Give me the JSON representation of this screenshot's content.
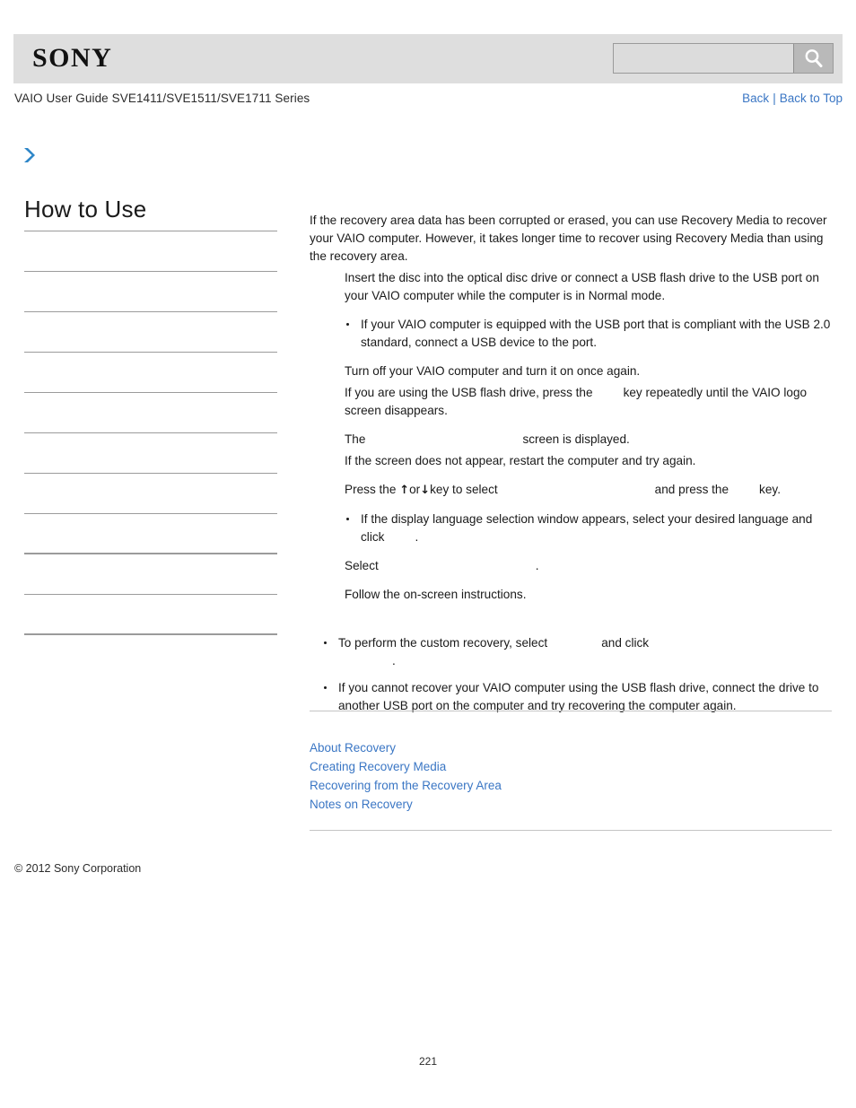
{
  "header": {
    "logo_text": "SONY",
    "search": {
      "value": "",
      "placeholder": "",
      "icon": "search-icon",
      "button_label": ""
    },
    "guide_title": "VAIO User Guide SVE1411/SVE1511/SVE1711 Series",
    "nav": {
      "back_label": "Back",
      "separator": "|",
      "back_to_top_label": "Back to Top"
    },
    "breadcrumb_icon": "chevron-right-icon"
  },
  "sidebar": {
    "title": "How to Use",
    "items": [
      {
        "label": ""
      },
      {
        "label": ""
      },
      {
        "label": ""
      },
      {
        "label": ""
      },
      {
        "label": ""
      },
      {
        "label": ""
      },
      {
        "label": ""
      },
      {
        "label": ""
      },
      {
        "label": ""
      },
      {
        "label": ""
      }
    ]
  },
  "content": {
    "intro": "If the recovery area data has been corrupted or erased, you can use Recovery Media to recover your VAIO computer. However, it takes longer time to recover using Recovery Media than using the recovery area.",
    "step1": "Insert the disc into the optical disc drive or connect a USB flash drive to the USB port on your VAIO computer while the computer is in Normal mode.",
    "note1": "If your VAIO computer is equipped with the USB port that is compliant with the USB 2.0 standard, connect a USB device to the port.",
    "step2_line1": "Turn off your VAIO computer and turn it on once again.",
    "step2_line2_a": "If you are using the USB flash drive, press the",
    "step2_line2_b": "key repeatedly until the VAIO logo screen disappears.",
    "step3_line1_a": "The",
    "step3_line1_b": "screen is displayed.",
    "step3_line2": "If the screen does not appear, restart the computer and try again.",
    "step4_a": "Press the",
    "step4_arrow_up": "↑",
    "step4_or": "or",
    "step4_arrow_down": "↓",
    "step4_b": "key to select",
    "step4_c": "and press the",
    "step4_d": "key.",
    "note2_a": "If the display language selection window appears, select your desired language and click",
    "note2_b": ".",
    "step5_a": "Select",
    "step5_b": ".",
    "step6": "Follow the on-screen instructions."
  },
  "bottom_notes": {
    "note1_a": "To perform the custom recovery, select",
    "note1_b": "and click",
    "note1_c": ".",
    "note2": "If you cannot recover your VAIO computer using the USB flash drive, connect the drive to another USB port on the computer and try recovering the computer again."
  },
  "related_links": [
    {
      "label": "About Recovery"
    },
    {
      "label": "Creating Recovery Media"
    },
    {
      "label": "Recovering from the Recovery Area"
    },
    {
      "label": "Notes on Recovery"
    }
  ],
  "footer": {
    "copyright": "© 2012 Sony Corporation",
    "page_number": "221"
  },
  "colors": {
    "link": "#3a76c4",
    "header_band": "#dedede",
    "rule": "#9b9b9b",
    "accent_arrow": "#2e86c8"
  }
}
